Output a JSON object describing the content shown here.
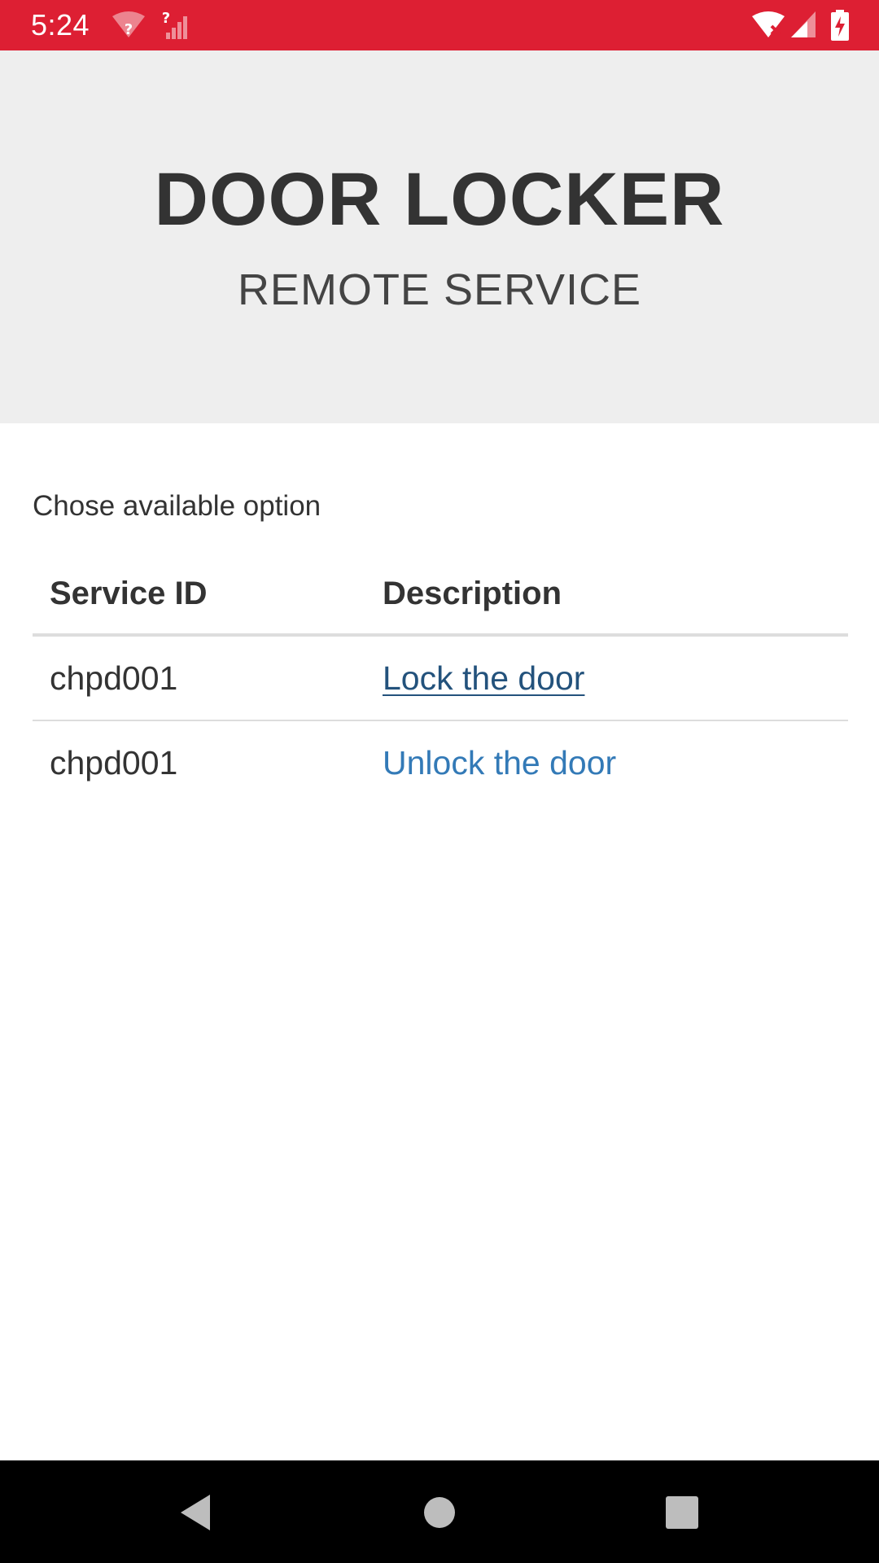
{
  "status_bar": {
    "time": "5:24",
    "background_color": "#dd1f33",
    "icons": [
      "wifi-question-icon",
      "signal-question-icon",
      "wifi-x-icon",
      "cell-signal-icon",
      "battery-charging-icon"
    ]
  },
  "header": {
    "title": "DOOR LOCKER",
    "subtitle": "REMOTE SERVICE"
  },
  "main": {
    "prompt": "Chose available option",
    "table": {
      "columns": [
        "Service ID",
        "Description"
      ],
      "rows": [
        {
          "service_id": "chpd001",
          "description": "Lock the door"
        },
        {
          "service_id": "chpd001",
          "description": "Unlock the door"
        }
      ]
    },
    "link_color": "#337ab7"
  },
  "nav_bar": {
    "icons": [
      "back-icon",
      "home-icon",
      "recents-icon"
    ]
  }
}
